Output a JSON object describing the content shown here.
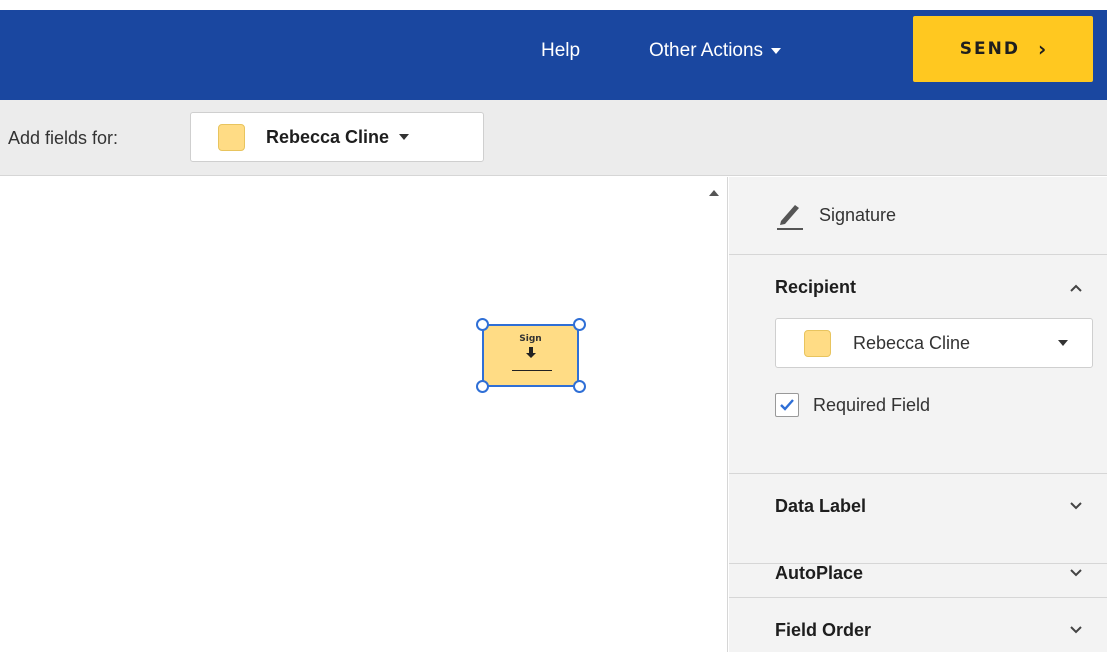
{
  "topbar": {
    "help_label": "Help",
    "other_actions_label": "Other Actions",
    "send_label": "SEND",
    "send_chevron": "›"
  },
  "subbar": {
    "add_fields_label": "Add fields for:",
    "recipient_name": "Rebecca Cline"
  },
  "field": {
    "sign_label": "Sign",
    "arrow_glyph": "🡇"
  },
  "panel": {
    "field_type_label": "Signature",
    "recipient": {
      "title": "Recipient",
      "selected": "Rebecca Cline",
      "required_label": "Required Field",
      "required_checked": true
    },
    "sections": [
      {
        "title": "Data Label"
      },
      {
        "title": "AutoPlace"
      },
      {
        "title": "Field Order"
      }
    ]
  },
  "colors": {
    "topbar": "#1a47a0",
    "send_button": "#ffc820",
    "recipient_swatch": "#ffdc85",
    "selection_blue": "#2f6fd6"
  },
  "icons": [
    "caret-down-icon",
    "chevron-right-icon",
    "pen-icon",
    "chevron-up-icon",
    "chevron-down-icon",
    "checkmark-icon",
    "scroll-up-icon",
    "download-arrow-icon"
  ]
}
